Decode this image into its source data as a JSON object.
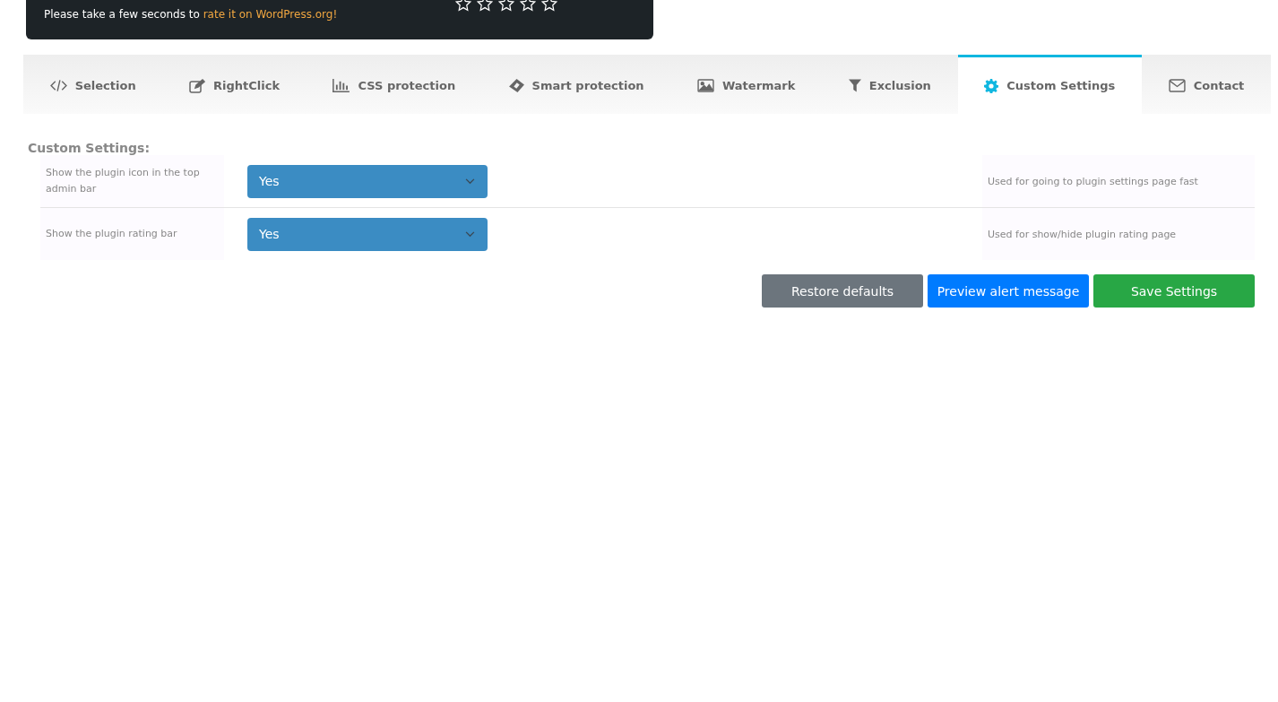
{
  "banner": {
    "text_before": "Please take a few seconds to ",
    "link": "rate it on WordPress.org!",
    "stars": 0
  },
  "tabs": [
    {
      "label": "Selection",
      "kind": "code",
      "selected": false
    },
    {
      "label": "RightClick",
      "kind": "edit",
      "selected": false
    },
    {
      "label": "CSS protection",
      "kind": "chart",
      "selected": false
    },
    {
      "label": "Smart protection",
      "kind": "tag",
      "selected": false
    },
    {
      "label": "Watermark",
      "kind": "image",
      "selected": false
    },
    {
      "label": "Exclusion",
      "kind": "filter",
      "selected": false
    },
    {
      "label": "Custom Settings",
      "kind": "gear",
      "selected": true
    },
    {
      "label": "Contact",
      "kind": "mail",
      "selected": false
    }
  ],
  "section_title": "Custom Settings:",
  "settings": [
    {
      "label": "Show the plugin icon in the top admin bar",
      "value": "Yes",
      "description": "Used for going to plugin settings page fast"
    },
    {
      "label": "Show the plugin rating bar",
      "value": "Yes",
      "description": "Used for show/hide plugin rating page"
    }
  ],
  "buttons": [
    {
      "label": "Restore defaults",
      "kind": "secondary"
    },
    {
      "label": "Preview alert message",
      "kind": "primary"
    },
    {
      "label": "Save Settings",
      "kind": "success"
    }
  ]
}
